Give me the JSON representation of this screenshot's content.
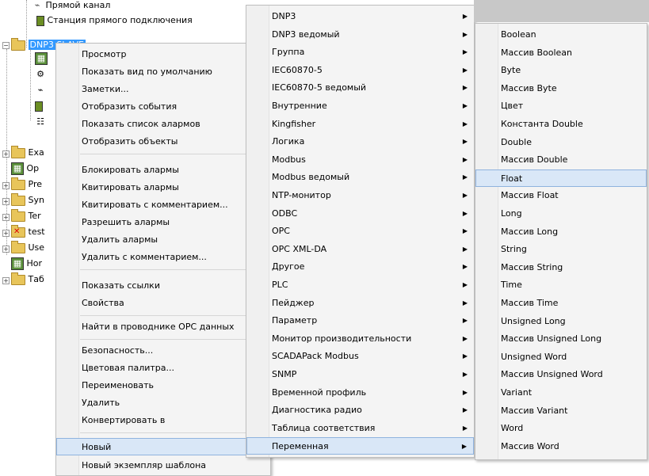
{
  "tree": {
    "top_item": "Прямой канал",
    "station_item": "Станция прямого подключения",
    "selected_item": "DNP3 SLAVE",
    "partial_items": [
      "Exa",
      "Op",
      "Pre",
      "Syn",
      "Ter",
      "test",
      "Use",
      "Hor",
      "Таб"
    ]
  },
  "context_menu": {
    "items": [
      {
        "label": "Просмотр"
      },
      {
        "label": "Показать вид по умолчанию"
      },
      {
        "label": "Заметки..."
      },
      {
        "label": "Отобразить события"
      },
      {
        "label": "Показать список алармов"
      },
      {
        "label": "Отобразить объекты"
      },
      {
        "label": "Блокировать алармы"
      },
      {
        "label": "Квитировать алармы"
      },
      {
        "label": "Квитировать с комментарием..."
      },
      {
        "label": "Разрешить алармы"
      },
      {
        "label": "Удалить алармы"
      },
      {
        "label": "Удалить с комментарием..."
      },
      {
        "label": "Показать ссылки"
      },
      {
        "label": "Свойства"
      },
      {
        "label": "Найти в проводнике OPC данных"
      },
      {
        "label": "Безопасность..."
      },
      {
        "label": "Цветовая палитра..."
      },
      {
        "label": "Переименовать"
      },
      {
        "label": "Удалить"
      },
      {
        "label": "Конвертировать в"
      },
      {
        "label": "Новый"
      },
      {
        "label": "Новый экземпляр шаблона"
      }
    ]
  },
  "new_submenu": {
    "items": [
      {
        "label": "DNP3"
      },
      {
        "label": "DNP3 ведомый"
      },
      {
        "label": "Группа"
      },
      {
        "label": "IEC60870-5"
      },
      {
        "label": "IEC60870-5 ведомый"
      },
      {
        "label": "Внутренние"
      },
      {
        "label": "Kingfisher"
      },
      {
        "label": "Логика"
      },
      {
        "label": "Modbus"
      },
      {
        "label": "Modbus ведомый"
      },
      {
        "label": "NTP-монитор"
      },
      {
        "label": "ODBC"
      },
      {
        "label": "OPC"
      },
      {
        "label": "OPC XML-DA"
      },
      {
        "label": "Другое"
      },
      {
        "label": "PLC"
      },
      {
        "label": "Пейджер"
      },
      {
        "label": "Параметр"
      },
      {
        "label": "Монитор производительности"
      },
      {
        "label": "SCADAPack Modbus"
      },
      {
        "label": "SNMP"
      },
      {
        "label": "Временной профиль"
      },
      {
        "label": "Диагностика радио"
      },
      {
        "label": "Таблица соответствия"
      },
      {
        "label": "Переменная"
      }
    ]
  },
  "variable_submenu": {
    "items": [
      {
        "label": "Boolean"
      },
      {
        "label": "Массив Boolean"
      },
      {
        "label": "Byte"
      },
      {
        "label": "Массив Byte"
      },
      {
        "label": "Цвет"
      },
      {
        "label": "Константа Double"
      },
      {
        "label": "Double"
      },
      {
        "label": "Массив Double"
      },
      {
        "label": "Float"
      },
      {
        "label": "Массив Float"
      },
      {
        "label": "Long"
      },
      {
        "label": "Массив Long"
      },
      {
        "label": "String"
      },
      {
        "label": "Массив String"
      },
      {
        "label": "Time"
      },
      {
        "label": "Массив Time"
      },
      {
        "label": "Unsigned Long"
      },
      {
        "label": "Массив Unsigned Long"
      },
      {
        "label": "Unsigned Word"
      },
      {
        "label": "Массив Unsigned Word"
      },
      {
        "label": "Variant"
      },
      {
        "label": "Массив Variant"
      },
      {
        "label": "Word"
      },
      {
        "label": "Массив Word"
      }
    ]
  },
  "icons": {
    "submenu_arrow": "▶",
    "expand": "+",
    "collapse": "−"
  },
  "colors": {
    "highlight_bg": "#d9e7f7",
    "highlight_border": "#8fb3de",
    "selection": "#3399ff"
  }
}
